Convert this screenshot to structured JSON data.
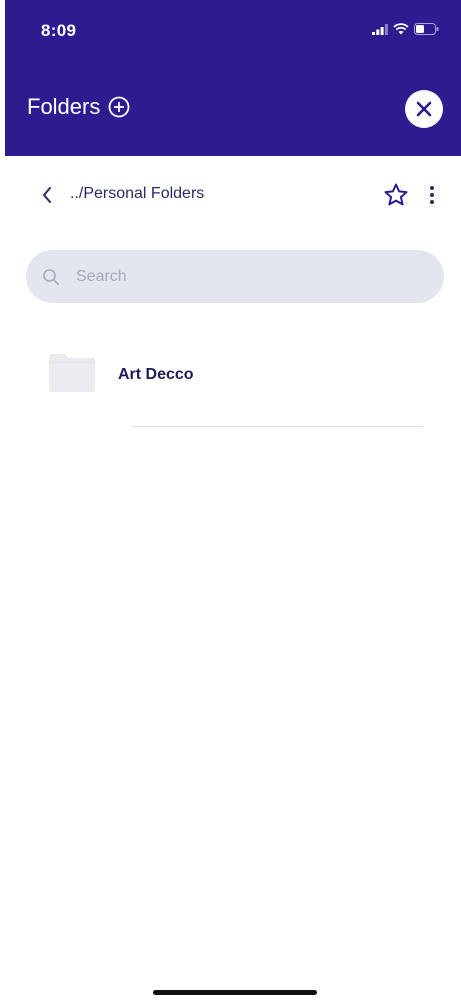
{
  "status_bar": {
    "time": "8:09"
  },
  "header": {
    "title": "Folders",
    "add_icon": "plus-circle-icon",
    "close_icon": "close-icon"
  },
  "nav": {
    "back_icon": "chevron-left-icon",
    "breadcrumb": "../Personal Folders",
    "star_icon": "star-outline-icon",
    "more_icon": "more-vertical-icon"
  },
  "search": {
    "placeholder": "Search",
    "value": ""
  },
  "folders": [
    {
      "name": "Art Decco",
      "icon": "folder-icon"
    }
  ],
  "colors": {
    "header_bg": "#2e1b8f",
    "text_primary": "#1d1d5c",
    "search_bg": "#e4e6ef"
  }
}
